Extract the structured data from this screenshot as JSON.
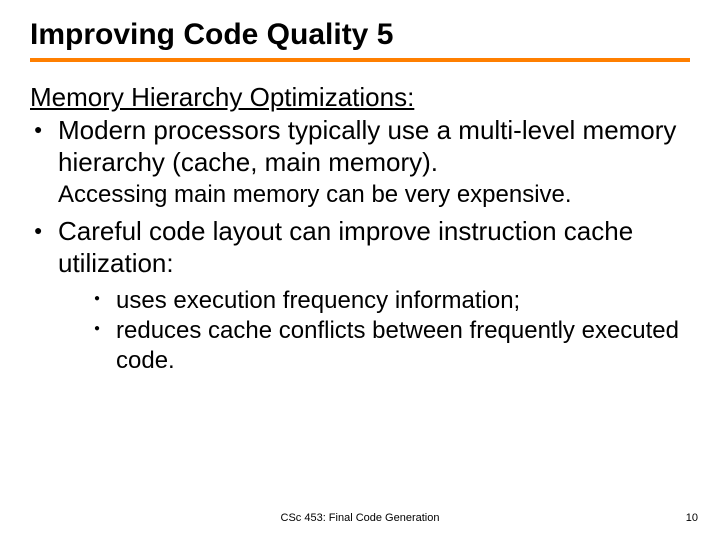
{
  "title": "Improving Code Quality 5",
  "section_heading": "Memory Hierarchy Optimizations:",
  "bullets": [
    {
      "text": "Modern processors typically use a multi-level memory hierarchy (cache, main memory).",
      "sub_text": "Accessing main memory can be very expensive."
    },
    {
      "text": "Careful code layout can improve instruction cache utilization:",
      "sub_bullets": [
        "uses execution frequency information;",
        "reduces cache conflicts between frequently executed code."
      ]
    }
  ],
  "footer_center": "CSc 453: Final Code Generation",
  "footer_right": "10"
}
